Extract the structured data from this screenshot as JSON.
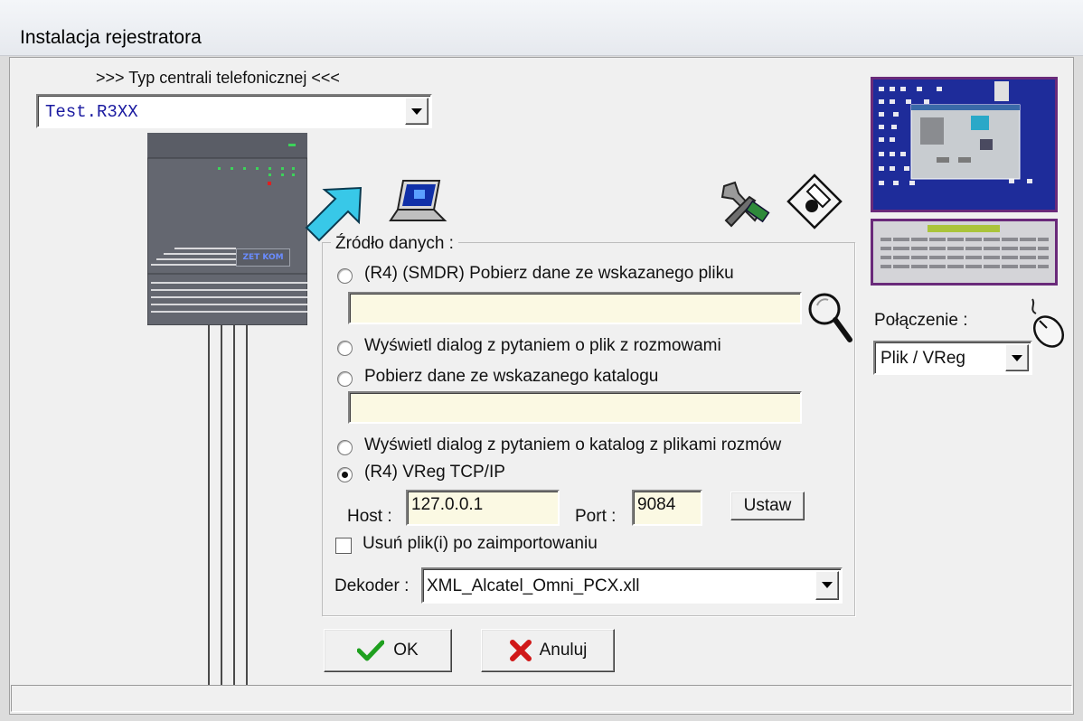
{
  "window": {
    "title": "Instalacja rejestratora"
  },
  "exchange": {
    "heading": ">>> Typ centrali telefonicznej <<<",
    "selected": "Test.R3XX",
    "device_badge": "ZET KOM"
  },
  "source": {
    "group_title": "Źródło danych :",
    "options": [
      {
        "label": "(R4) (SMDR) Pobierz dane ze wskazanego pliku",
        "selected": false
      },
      {
        "label": "Wyświetl dialog z pytaniem o plik z rozmowami",
        "selected": false
      },
      {
        "label": "Pobierz dane ze wskazanego katalogu",
        "selected": false
      },
      {
        "label": "Wyświetl dialog z pytaniem o katalog z plikami rozmów",
        "selected": false
      },
      {
        "label": "(R4) VReg TCP/IP",
        "selected": true
      }
    ],
    "file_path": "",
    "dir_path": "",
    "host_label": "Host :",
    "host_value": "127.0.0.1",
    "port_label": "Port :",
    "port_value": "9084",
    "set_button": "Ustaw",
    "delete_label": "Usuń plik(i) po zaimportowaniu",
    "delete_checked": false,
    "decoder_label": "Dekoder :",
    "decoder_value": "XML_Alcatel_Omni_PCX.xll"
  },
  "connection": {
    "label": "Połączenie :",
    "value": "Plik / VReg"
  },
  "buttons": {
    "ok": "OK",
    "cancel": "Anuluj"
  },
  "colors": {
    "accent": "#1a1aa0",
    "field_yellow": "#fbf9e3",
    "preview_border": "#6a2a7a"
  }
}
